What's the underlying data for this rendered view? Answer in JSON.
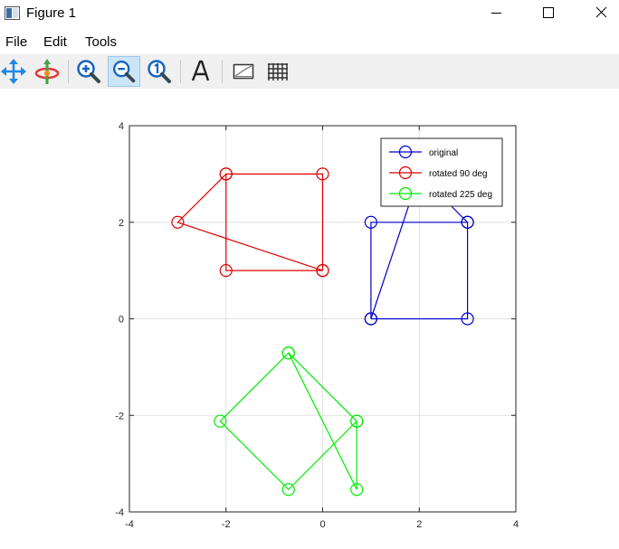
{
  "window": {
    "title": "Figure 1",
    "menu": [
      "File",
      "Edit",
      "Tools"
    ]
  },
  "toolbar": {
    "buttons": [
      {
        "icon": "pan-icon",
        "active": false
      },
      {
        "icon": "rotate-3d-icon",
        "active": false
      },
      {
        "icon": "zoom-in-icon",
        "active": false
      },
      {
        "icon": "zoom-out-icon",
        "active": true
      },
      {
        "icon": "zoom-reset-icon",
        "active": false
      },
      {
        "icon": "insert-text-icon",
        "active": false
      },
      {
        "icon": "toggle-axes-icon",
        "active": false
      },
      {
        "icon": "toggle-grid-icon",
        "active": false
      }
    ]
  },
  "chart_data": {
    "type": "line",
    "marker": "circle",
    "xlim": [
      -4,
      4
    ],
    "ylim": [
      -4,
      4
    ],
    "xticks": [
      -4,
      -2,
      0,
      2,
      4
    ],
    "yticks": [
      -4,
      -2,
      0,
      2,
      4
    ],
    "x_tick_labels": [
      "-4",
      "-2",
      "0",
      "2",
      "4"
    ],
    "y_tick_labels": [
      "-4",
      "-2",
      "0",
      "2",
      "4"
    ],
    "grid": true,
    "legend_position": "top-right",
    "series": [
      {
        "name": "original",
        "color": "#0000cc",
        "x": [
          1,
          3,
          3,
          1,
          1,
          2,
          3
        ],
        "y": [
          0,
          0,
          2,
          2,
          0,
          3,
          2
        ]
      },
      {
        "name": "rotated 90 deg",
        "color": "#dd0000",
        "x": [
          0,
          0,
          -2,
          -2,
          0,
          -3,
          -2
        ],
        "y": [
          1,
          3,
          3,
          1,
          1,
          2,
          3
        ]
      },
      {
        "name": "rotated 225 deg",
        "color": "#00ee00",
        "x": [
          -0.707,
          0.707,
          -0.707,
          -2.121,
          -0.707,
          0.707,
          0.707
        ],
        "y": [
          -0.707,
          -2.121,
          -3.536,
          -2.121,
          -0.707,
          -3.536,
          -2.121
        ]
      }
    ]
  }
}
